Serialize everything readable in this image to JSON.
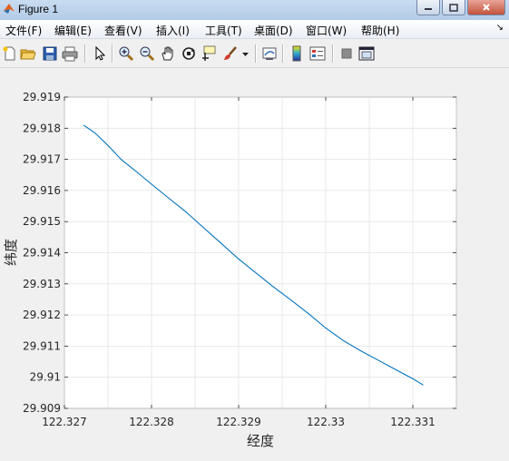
{
  "window": {
    "title": "Figure 1"
  },
  "menu": {
    "items": [
      {
        "label": "文件(F)"
      },
      {
        "label": "编辑(E)"
      },
      {
        "label": "查看(V)"
      },
      {
        "label": "插入(I)"
      },
      {
        "label": "工具(T)"
      },
      {
        "label": "桌面(D)"
      },
      {
        "label": "窗口(W)"
      },
      {
        "label": "帮助(H)"
      }
    ],
    "overflow_icon": "menu-overflow-arrow"
  },
  "toolbar": {
    "icons": [
      "new-figure-icon",
      "open-file-icon",
      "save-icon",
      "print-icon",
      "select-arrow-icon",
      "zoom-in-icon",
      "zoom-out-icon",
      "pan-hand-icon",
      "rotate-3d-icon",
      "data-cursor-icon",
      "brush-icon",
      "brush-dropdown-icon",
      "link-plot-icon",
      "colorbar-icon",
      "legend-icon",
      "hide-tools-icon",
      "dock-icon"
    ]
  },
  "chart_data": {
    "type": "line",
    "title": "",
    "xlabel": "经度",
    "ylabel": "纬度",
    "xlim": [
      122.327,
      122.3315
    ],
    "ylim": [
      29.909,
      29.919
    ],
    "xticks": [
      122.327,
      122.328,
      122.329,
      122.33,
      122.331
    ],
    "xtick_labels": [
      "122.327",
      "122.328",
      "122.329",
      "122.33",
      "122.331"
    ],
    "yticks": [
      29.909,
      29.91,
      29.911,
      29.912,
      29.913,
      29.914,
      29.915,
      29.916,
      29.917,
      29.918,
      29.919
    ],
    "ytick_labels": [
      "29.909",
      "29.91",
      "29.911",
      "29.912",
      "29.913",
      "29.914",
      "29.915",
      "29.916",
      "29.917",
      "29.918",
      "29.919"
    ],
    "grid": true,
    "line_color": "#0072bd",
    "series": [
      {
        "x": [
          122.32722,
          122.32735,
          122.3275,
          122.32765,
          122.32785,
          122.328,
          122.3282,
          122.3284,
          122.3286,
          122.3288,
          122.329,
          122.3292,
          122.3294,
          122.3296,
          122.3298,
          122.33,
          122.3302,
          122.3304,
          122.3306,
          122.3308,
          122.331,
          122.33112
        ],
        "y": [
          29.9181,
          29.91785,
          29.91745,
          29.917,
          29.91655,
          29.9162,
          29.91575,
          29.9153,
          29.9148,
          29.9143,
          29.9138,
          29.91335,
          29.9129,
          29.91248,
          29.91205,
          29.91158,
          29.91118,
          29.91085,
          29.91055,
          29.91025,
          29.90995,
          29.90975
        ]
      }
    ]
  }
}
